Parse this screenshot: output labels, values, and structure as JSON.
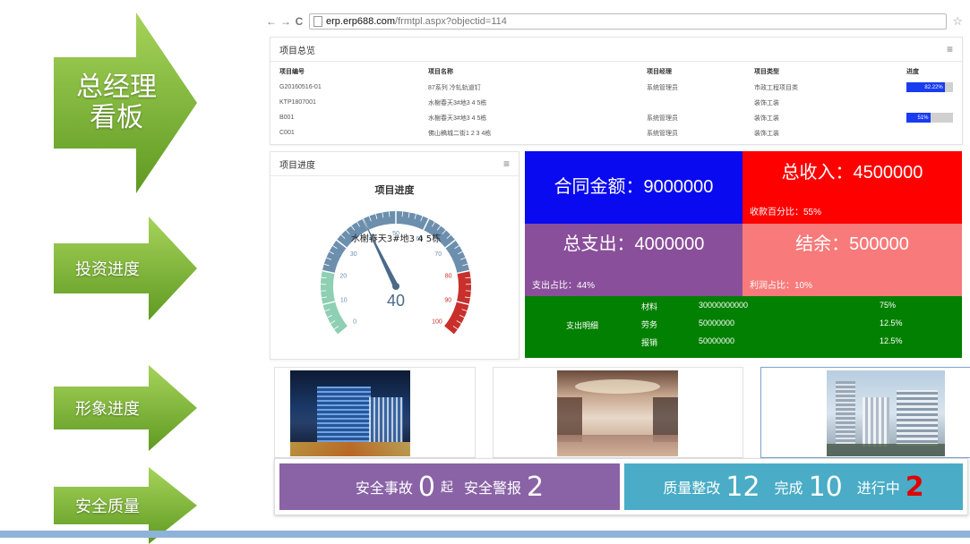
{
  "colors": {
    "arrow_green": "#7fb63a",
    "contract_blue": "#0a0af0",
    "income_red": "#ff0000",
    "expense_purple": "#8a4f9a",
    "balance_pink": "#f87a7a",
    "detail_green": "#028002",
    "safety_purple": "#8a63a6",
    "quality_teal": "#4aacc6",
    "progress_blue": "#1a3cf0"
  },
  "sidebar_arrows": [
    {
      "line1": "总经理",
      "line2": "看板"
    },
    {
      "label": "投资进度"
    },
    {
      "label": "形象进度"
    },
    {
      "label": "安全质量"
    }
  ],
  "browser": {
    "back_icon": "arrow-left-icon",
    "forward_icon": "arrow-right-icon",
    "reload_icon": "reload-icon",
    "url_domain": "erp.erp688.com",
    "url_path": "/frmtpl.aspx?objectid=114"
  },
  "overview": {
    "title": "项目总览",
    "headers": [
      "项目编号",
      "项目名称",
      "项目经理",
      "项目类型",
      "进度"
    ],
    "rows": [
      {
        "code": "G20160516-01",
        "name": "87系列 冷轧轨道钉",
        "manager": "系统管理员",
        "type": "市政工程项目类",
        "progress_label": "82.22%",
        "progress": 82.22
      },
      {
        "code": "KTP1807001",
        "name": "水榭春天3#地3 4 5栋",
        "manager": "",
        "type": "装饰工装",
        "progress_label": "",
        "progress": null
      },
      {
        "code": "B001",
        "name": "水榭春天3#地3 4 5栋",
        "manager": "系统管理员",
        "type": "装饰工装",
        "progress_label": "51%",
        "progress": 51
      },
      {
        "code": "C001",
        "name": "佛山稿城二街1 2 3 4栋",
        "manager": "系统管理员",
        "type": "装饰工装",
        "progress_label": "",
        "progress": null
      }
    ]
  },
  "gauge_panel": {
    "title": "项目进度",
    "chart_title": "项目进度",
    "series_label": "水榭春天3#地3 4 5栋",
    "value": 40,
    "value_label": "40",
    "min": 0,
    "max": 100,
    "tick_labels": [
      "0",
      "10",
      "20",
      "30",
      "40",
      "50",
      "60",
      "70",
      "80",
      "90",
      "100"
    ]
  },
  "finance": {
    "contract": "合同金额：9000000",
    "income": "总收入：4500000",
    "income_ratio": "收款百分比：55%",
    "expense": "总支出：4000000",
    "expense_ratio": "支出占比：44%",
    "balance": "结余：500000",
    "profit_ratio": "利润占比：10%",
    "detail_label": "支出明细",
    "details": [
      {
        "item": "材料",
        "amount": "30000000000",
        "ratio": "75%"
      },
      {
        "item": "劳务",
        "amount": "50000000",
        "ratio": "12.5%"
      },
      {
        "item": "报销",
        "amount": "50000000",
        "ratio": "12.5%"
      }
    ]
  },
  "safety": {
    "accident_label": "安全事故",
    "accident_count": "0",
    "accident_unit": "起",
    "alarm_label": "安全警报",
    "alarm_count": "2",
    "rectify_label": "质量整改",
    "rectify_count": "12",
    "done_label": "完成",
    "done_count": "10",
    "ongoing_label": "进行中",
    "ongoing_count": "2"
  }
}
